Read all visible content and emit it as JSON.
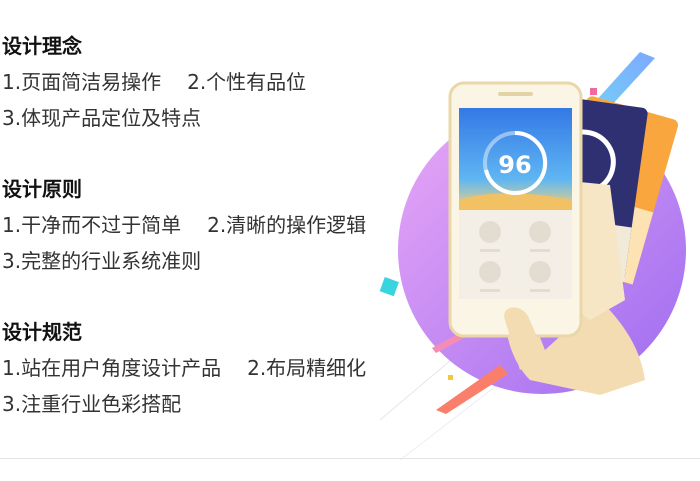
{
  "sections": [
    {
      "title": "设计理念",
      "items": [
        "1.页面简洁易操作",
        "2.个性有品位",
        "3.体现产品定位及特点"
      ]
    },
    {
      "title": "设计原则",
      "items": [
        "1.干净而不过于简单",
        "2.清晰的操作逻辑",
        "3.完整的行业系统准则"
      ]
    },
    {
      "title": "设计规范",
      "items": [
        "1.站在用户角度设计产品",
        "2.布局精细化",
        "3.注重行业色彩搭配"
      ]
    }
  ],
  "phone": {
    "score": "96"
  },
  "colors": {
    "purple": "#c07ef0",
    "phone_blue": "#3d8be8",
    "card_orange": "#f7a13a",
    "card_navy": "#2c2f6e"
  }
}
